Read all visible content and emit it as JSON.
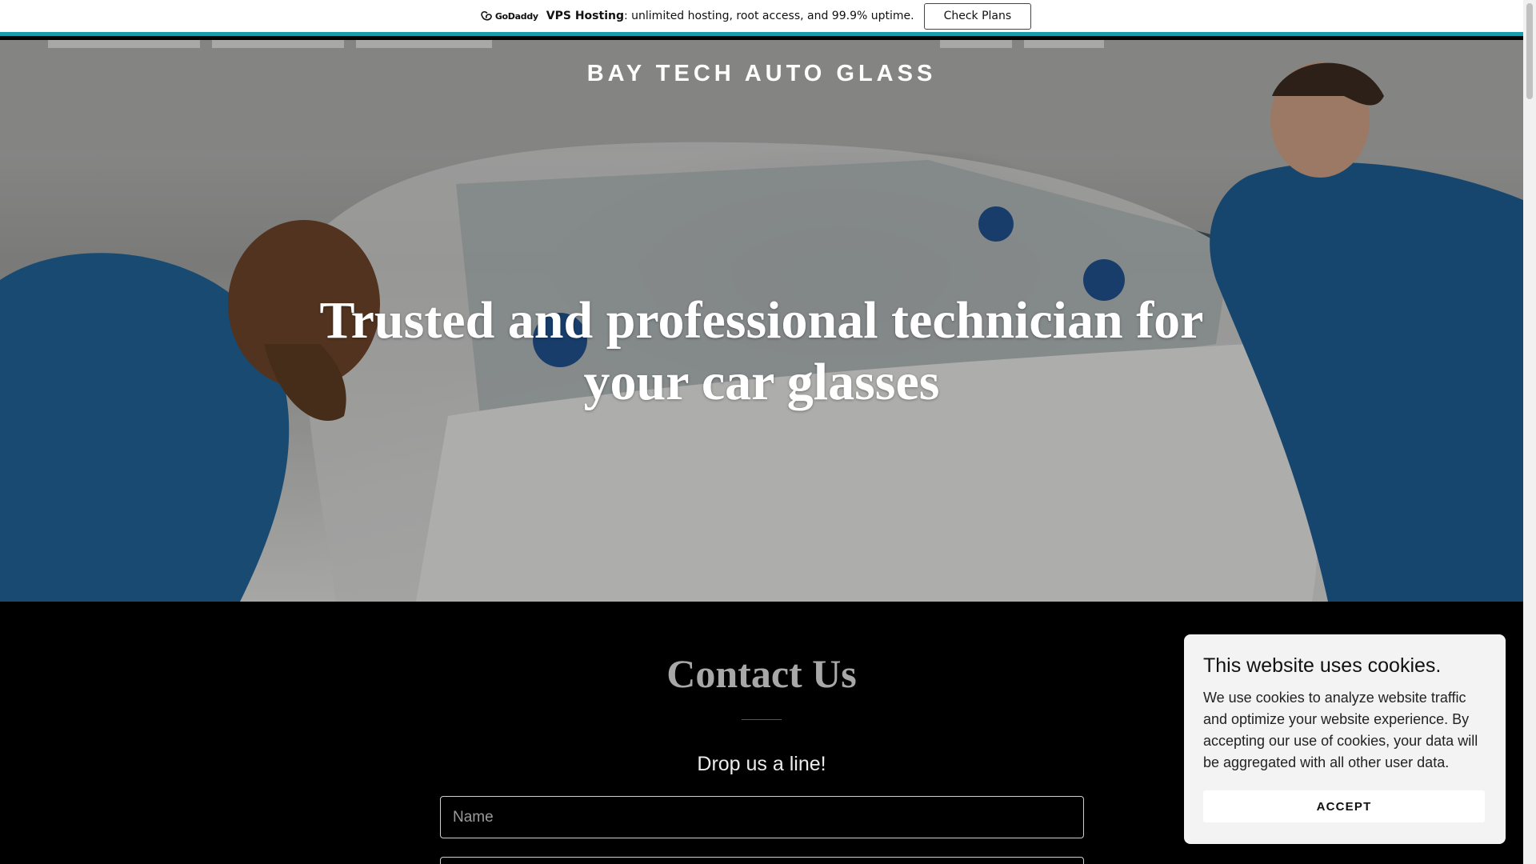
{
  "promo": {
    "logo_text": "GoDaddy",
    "product": "VPS Hosting",
    "description": ": unlimited hosting, root access, and 99.9% uptime.",
    "cta_label": "Check Plans",
    "accent_color": "#1a9bab"
  },
  "hero": {
    "brand": "BAY TECH AUTO GLASS",
    "headline": "Trusted and professional technician for your car glasses"
  },
  "contact": {
    "title": "Contact Us",
    "subtitle": "Drop us a line!",
    "name_placeholder": "Name"
  },
  "cookie": {
    "title": "This website uses cookies.",
    "body": "We use cookies to analyze website traffic and optimize your website experience. By accepting our use of cookies, your data will be aggregated with all other user data.",
    "accept_label": "ACCEPT"
  },
  "icons": {
    "godaddy_logo": "godaddy-logo-icon"
  }
}
